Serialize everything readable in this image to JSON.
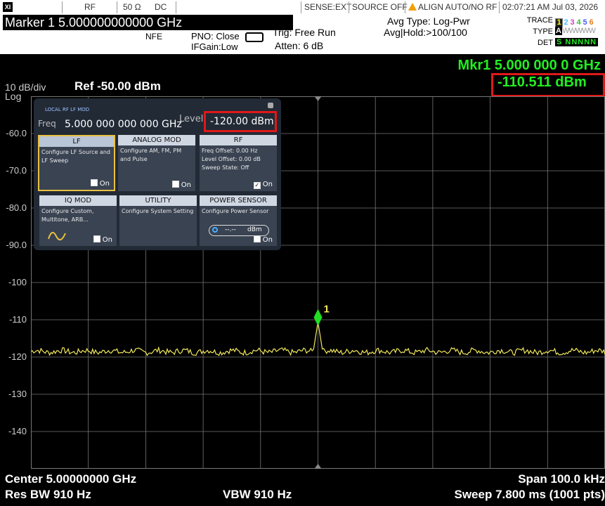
{
  "status_bar": {
    "logo": "XI",
    "input": "RF",
    "impedance": "50 Ω",
    "coupling": "DC",
    "sense": "SENSE:EXT",
    "source": "SOURCE OFF",
    "align": "ALIGN AUTO/NO RF",
    "datetime": "02:07:21 AM Jul 03, 2026"
  },
  "header": {
    "marker_title": "Marker 1  5.000000000000 GHz",
    "nfe": "NFE",
    "pno": "PNO: Close",
    "ifgain": "IFGain:Low",
    "trig": "Trig: Free Run",
    "atten": "Atten: 6 dB",
    "avg_type": "Avg Type: Log-Pwr",
    "avg_hold": "Avg|Hold:>100/100",
    "trace_label": "TRACE",
    "type_label": "TYPE",
    "det_label": "DET",
    "trace_numbers": [
      "1",
      "2",
      "3",
      "4",
      "5",
      "6"
    ],
    "type_value": "A",
    "type_rest": "WWWWW",
    "det_value": "S NNNNN"
  },
  "marker_readout": {
    "freq": "Mkr1 5.000 000 0 GHz",
    "level": "-110.511 dBm"
  },
  "scale": {
    "per_div": "10 dB/div",
    "log": "Log",
    "ref": "Ref -50.00 dBm"
  },
  "y_tick_labels": [
    "-60.0",
    "-70.0",
    "-80.0",
    "-90.0",
    "-100",
    "-110",
    "-120",
    "-130",
    "-140"
  ],
  "marker_label": "1",
  "siggen": {
    "mode": "LOCAL RF LF MOD",
    "freq_label": "Freq",
    "freq_value": "5.000 000 000 000 GHz",
    "level_label": "Level",
    "level_value": "-120.00  dBm",
    "tiles": [
      {
        "title": "LF",
        "desc": "Configure LF Source and LF Sweep",
        "on": "On"
      },
      {
        "title": "ANALOG MOD",
        "desc": "Configure AM, FM, PM and Pulse",
        "on": "On"
      },
      {
        "title": "RF",
        "desc": "Freq Offset: 0.00 Hz\nLevel Offset: 0.00 dB\nSweep State: Off",
        "on": "On"
      },
      {
        "title": "IQ MOD",
        "desc": "Configure Custom, Multitone, ARB...",
        "on": "On"
      },
      {
        "title": "UTILITY",
        "desc": "Configure System Setting",
        "on": ""
      },
      {
        "title": "POWER SENSOR",
        "desc": "Configure Power Sensor",
        "on": "On"
      }
    ],
    "sensor_reading": "--.--",
    "sensor_unit": "dBm"
  },
  "footer": {
    "center": "Center 5.00000000 GHz",
    "span": "Span 100.0 kHz",
    "res_bw": "Res BW 910 Hz",
    "vbw": "VBW 910 Hz",
    "sweep": "Sweep  7.800 ms (1001 pts)"
  },
  "colors": {
    "trace": "#f2e85c",
    "marker": "#22dd22",
    "readout": "#22ee22",
    "highlight": "#e01818",
    "grid": "#777777"
  },
  "chart_data": {
    "type": "line",
    "ylim": [
      -150,
      -50
    ],
    "xlim_ghz": [
      4.99995,
      5.00005
    ],
    "noise_floor_dbm": -118.5,
    "peak": {
      "x_ghz": 5.0,
      "y_dbm": -110.5
    }
  }
}
